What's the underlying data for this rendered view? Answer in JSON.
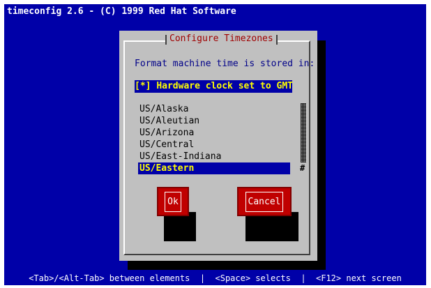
{
  "title_bar": {
    "text": "timeconfig 2.6 - (C) 1999 Red Hat Software"
  },
  "dialog": {
    "title": "Configure Timezones",
    "prompt": "Format machine time is stored in:",
    "checkbox": {
      "mark": "[*]",
      "label": "Hardware clock set to GMT",
      "checked": true
    },
    "timezones": [
      "US/Alaska",
      "US/Aleutian",
      "US/Arizona",
      "US/Central",
      "US/East-Indiana",
      "US/Eastern"
    ],
    "selected_timezone": "US/Eastern",
    "scroll_thumb": "#",
    "buttons": {
      "ok": "Ok",
      "cancel": "Cancel"
    }
  },
  "status_bar": {
    "text": "<Tab>/<Alt-Tab> between elements  |  <Space> selects  |  <F12> next screen"
  },
  "colors": {
    "screen_bg": "#0000a8",
    "dialog_bg": "#c0c0c0",
    "button_bg": "#c00000",
    "highlight_text": "#ffff00",
    "title_text": "#a00000"
  }
}
